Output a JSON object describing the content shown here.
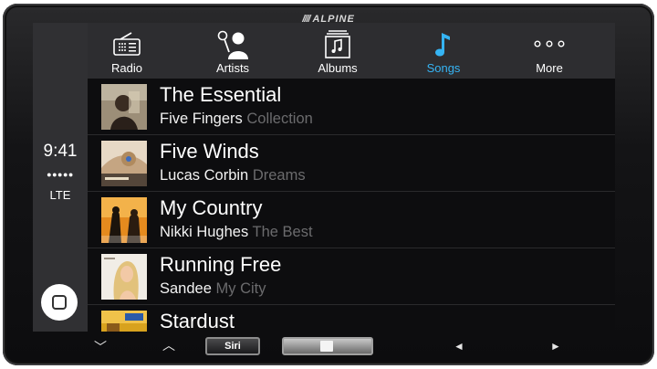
{
  "brand": {
    "name": "ALPINE"
  },
  "status": {
    "time": "9:41",
    "signal": "●●●●●",
    "network": "LTE"
  },
  "tabs": [
    {
      "label": "Radio",
      "icon": "radio-icon",
      "active": false
    },
    {
      "label": "Artists",
      "icon": "artist-icon",
      "active": false
    },
    {
      "label": "Albums",
      "icon": "albums-icon",
      "active": false
    },
    {
      "label": "Songs",
      "icon": "music-note-icon",
      "active": true
    },
    {
      "label": "More",
      "icon": "more-icon",
      "active": false
    }
  ],
  "songs": [
    {
      "title": "The Essential",
      "artist": "Five Fingers",
      "album": "Collection"
    },
    {
      "title": "Five Winds",
      "artist": "Lucas Corbin",
      "album": "Dreams"
    },
    {
      "title": "My Country",
      "artist": "Nikki Hughes",
      "album": "The Best"
    },
    {
      "title": "Running Free",
      "artist": "Sandee",
      "album": "My City"
    },
    {
      "title": "Stardust",
      "artist": "",
      "album": ""
    }
  ],
  "controls": {
    "siri_label": "Siri",
    "prev_symbol": "◄",
    "next_symbol": "►",
    "down_symbol": "﹀",
    "up_symbol": "︿"
  },
  "colors": {
    "accent": "#35b4f4",
    "album_text": "#6b6b6d"
  }
}
